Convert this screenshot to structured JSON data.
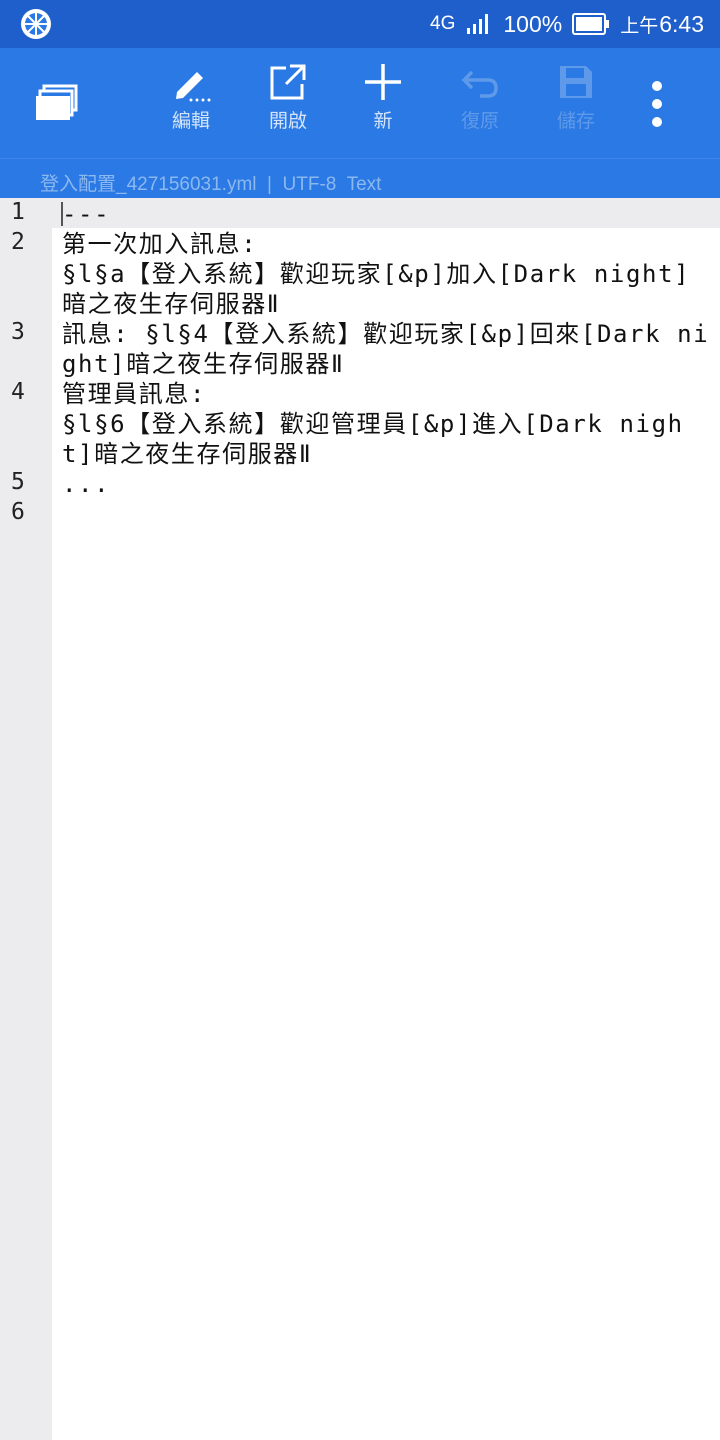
{
  "status_bar": {
    "network": "4G",
    "battery": "100%",
    "time_period": "上午",
    "time": "6:43"
  },
  "toolbar": {
    "edit_label": "編輯",
    "open_label": "開啟",
    "new_label": "新",
    "undo_label": "復原",
    "save_label": "儲存"
  },
  "file_info": {
    "text": "登入配置_427156031.yml  |  UTF-8  Text"
  },
  "editor": {
    "line_numbers": [
      "1",
      "2",
      "3",
      "4",
      "5",
      "6"
    ],
    "lines": [
      "---",
      "第一次加入訊息:\n§l§a【登入系統】歡迎玩家[&p]加入[Dark night]暗之夜生存伺服器Ⅱ",
      "訊息: §l§4【登入系統】歡迎玩家[&p]回來[Dark night]暗之夜生存伺服器Ⅱ",
      "管理員訊息:\n§l§6【登入系統】歡迎管理員[&p]進入[Dark night]暗之夜生存伺服器Ⅱ",
      "...",
      ""
    ]
  },
  "colors": {
    "status_bar": "#1e5fcc",
    "toolbar": "#2b79e4",
    "gutter": "#ececee"
  }
}
